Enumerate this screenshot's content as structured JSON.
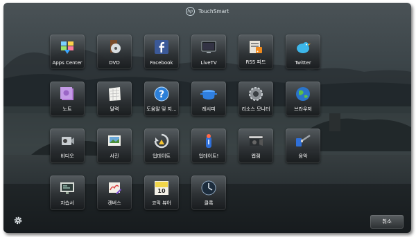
{
  "header": {
    "logo_text": "hp",
    "brand": "TouchSmart"
  },
  "apps": [
    {
      "label": "Apps Center",
      "icon": "apps-center-icon"
    },
    {
      "label": "DVD",
      "icon": "dvd-icon"
    },
    {
      "label": "Facebook",
      "icon": "facebook-icon"
    },
    {
      "label": "LiveTV",
      "icon": "livetv-icon"
    },
    {
      "label": "RSS 피드",
      "icon": "rss-icon"
    },
    {
      "label": "Twitter",
      "icon": "twitter-icon"
    },
    {
      "label": "노트",
      "icon": "notes-icon"
    },
    {
      "label": "달력",
      "icon": "calendar-icon"
    },
    {
      "label": "도움말 및 지...",
      "icon": "help-icon"
    },
    {
      "label": "레시피",
      "icon": "recipe-icon"
    },
    {
      "label": "리소스 모니터",
      "icon": "resource-monitor-icon"
    },
    {
      "label": "브라우저",
      "icon": "browser-icon"
    },
    {
      "label": "비디오",
      "icon": "video-icon"
    },
    {
      "label": "사진",
      "icon": "photo-icon"
    },
    {
      "label": "업데이트",
      "icon": "update-icon"
    },
    {
      "label": "업데이트!",
      "icon": "update-alert-icon"
    },
    {
      "label": "웹캠",
      "icon": "webcam-icon"
    },
    {
      "label": "음악",
      "icon": "music-icon"
    },
    {
      "label": "자습서",
      "icon": "tutorial-icon"
    },
    {
      "label": "캔버스",
      "icon": "canvas-icon"
    },
    {
      "label": "코믹 뷰어",
      "icon": "comic-viewer-icon"
    },
    {
      "label": "클록",
      "icon": "clock-icon"
    }
  ],
  "footer": {
    "settings_icon": "gear-icon",
    "cancel_label": "취소"
  }
}
